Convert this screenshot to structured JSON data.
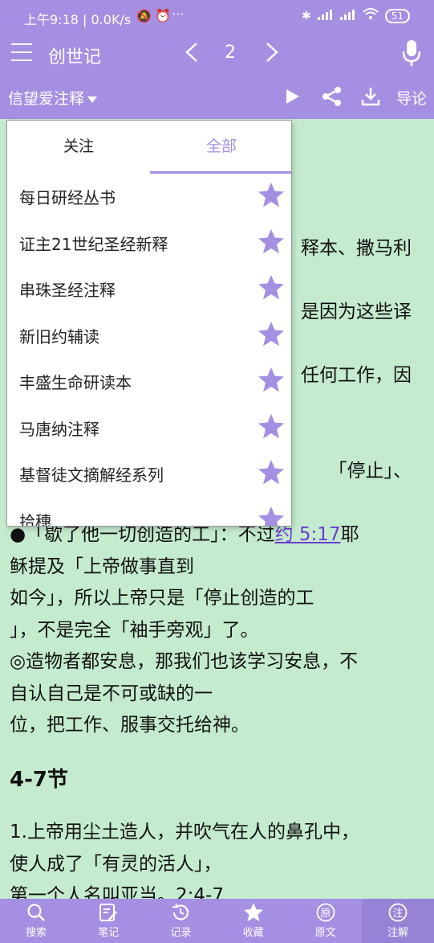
{
  "status": {
    "time_speed": "上午9:18 | 0.0K/s",
    "battery": "51"
  },
  "appbar": {
    "book_title": "创世记",
    "chapter": "2"
  },
  "toolbar": {
    "commentary_selector": "信望爱注释",
    "intro_label": "导论"
  },
  "popup": {
    "tabs": [
      "关注",
      "全部"
    ],
    "active_tab": "全部",
    "items": [
      "每日研经丛书",
      "证主21世纪圣经新释",
      "串珠圣经注释",
      "新旧约辅读",
      "丰盛生命研读本",
      "马唐纳注释",
      "基督徒文摘解经系列",
      "拾穗"
    ],
    "accent_color": "#a48fe3"
  },
  "content": {
    "fragments": [
      "释本、撒马利",
      "是因为这些译",
      "任何工作，因",
      "「停止」、"
    ],
    "p1_before_link": "●「歇了他一切创造的工」：不过",
    "p1_link": "约 5:17",
    "p1_after_link": "耶",
    "p1_line2": "稣提及「上帝做事直到",
    "p1_line3": "如今」，所以上帝只是「停止创造的工",
    "p1_line4": "」，不是完全「袖手旁观」了。",
    "p2_line1": "◎造物者都安息，那我们也该学习安息，不",
    "p2_line2": "自认自己是不可或缺的一",
    "p2_line3": "位，把工作、服事交托给神。",
    "section_title": "4-7节",
    "p3_line1": "1.上帝用尘土造人，并吹气在人的鼻孔中，",
    "p3_line2": "使人成了「有灵的活人」，",
    "p3_line3": "第一个人名叫亚当。2:4-7"
  },
  "bottom_nav": [
    {
      "label": "搜索",
      "icon": "search-icon"
    },
    {
      "label": "笔记",
      "icon": "note-edit-icon"
    },
    {
      "label": "记录",
      "icon": "history-icon"
    },
    {
      "label": "收藏",
      "icon": "star-icon"
    },
    {
      "label": "原文",
      "icon": "original-text-icon"
    },
    {
      "label": "注解",
      "icon": "commentary-icon"
    }
  ],
  "colors": {
    "bar": "#a48fe3",
    "content_bg": "#c5ebce",
    "star": "#a48fe3"
  }
}
